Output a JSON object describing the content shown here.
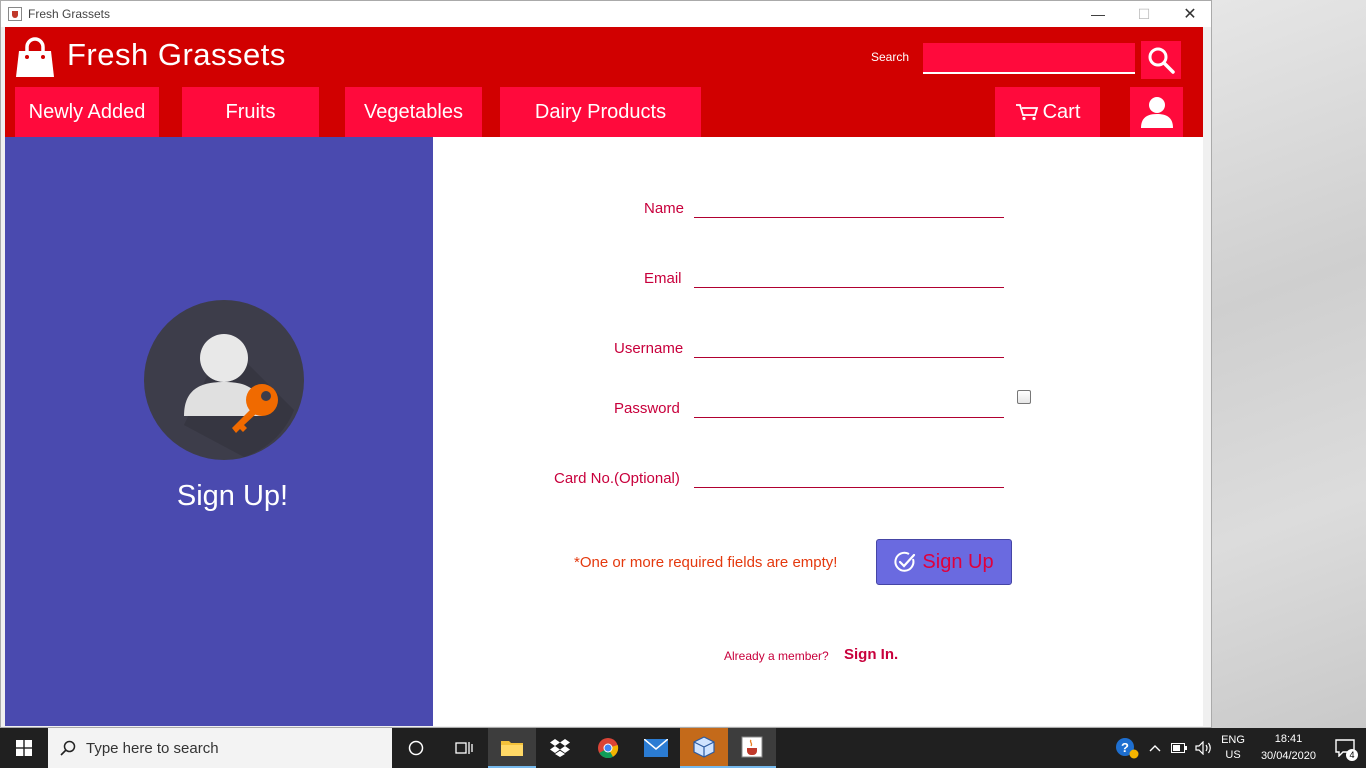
{
  "window": {
    "title": "Fresh Grassets",
    "minimize": "—",
    "maximize": "☐",
    "close": "✕"
  },
  "header": {
    "brand": "Fresh Grassets",
    "search_label": "Search",
    "search_value": "",
    "nav": [
      "Newly Added",
      "Fruits",
      "Vegetables",
      "Dairy Products"
    ],
    "cart_label": "Cart"
  },
  "left_panel": {
    "title": "Sign Up!"
  },
  "form": {
    "name_label": "Name",
    "email_label": "Email",
    "username_label": "Username",
    "password_label": "Password",
    "card_label": "Card No.(Optional)",
    "error": "*One or more required fields are empty!",
    "signup_button": "Sign Up",
    "member_text": "Already a member?",
    "signin_link": "Sign In."
  },
  "taskbar": {
    "search_placeholder": "Type here to search",
    "lang_top": "ENG",
    "lang_bottom": "US",
    "time": "18:41",
    "date": "30/04/2020",
    "notifications": "4"
  },
  "colors": {
    "header": "#d10000",
    "accent": "#ff0a3c",
    "panel": "#4a4aaf",
    "text_accent": "#c8003c"
  }
}
